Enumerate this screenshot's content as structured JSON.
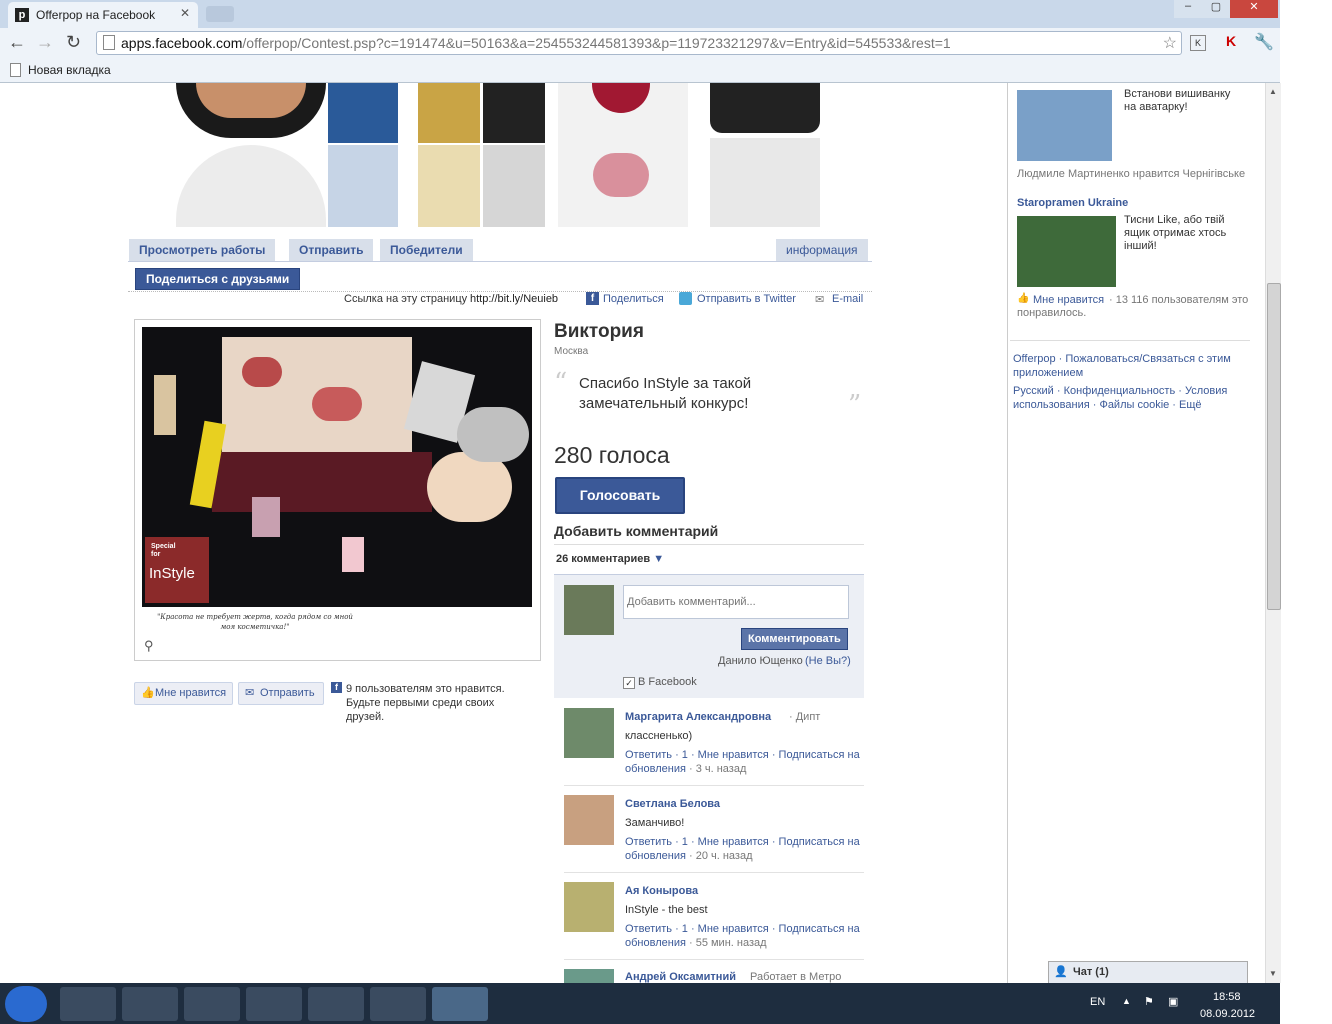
{
  "browser": {
    "tab_title": "Offerpop на Facebook",
    "url_host": "apps.facebook.com",
    "url_path": "/offerpop/Contest.psp?c=191474&u=50163&a=254553244581393&p=119723321297&v=Entry&id=545533&rest=1",
    "bookmark": "Новая вкладка"
  },
  "tabs": {
    "view": "Просмотреть работы",
    "send": "Отправить",
    "winners": "Победители",
    "info": "информация",
    "share": "Поделиться с друзьями"
  },
  "sharebar": {
    "link_label": "Ссылка на эту страницу",
    "link_url": "http://bit.ly/Neuieb",
    "share": "Поделиться",
    "twitter": "Отправить в Twitter",
    "email": "E-mail"
  },
  "entry": {
    "name": "Виктория",
    "city": "Москва",
    "quote": "Спасибо InStyle за такой замечательный конкурс!",
    "votes": "280 голоса",
    "vote_btn": "Голосовать",
    "badge_small": "Special for",
    "badge_big": "InStyle",
    "caption": "\"Красота не требует жертв, когда рядом со мной моя косметичка!\""
  },
  "likebar": {
    "like": "Мне нравится",
    "send": "Отправить",
    "text": "9 пользователям это нравится. Будьте первыми среди своих друзей."
  },
  "comments": {
    "title": "Добавить комментарий",
    "count": "26 комментариев",
    "placeholder": "Добавить комментарий...",
    "submit": "Комментировать",
    "user": "Данило Ющенко",
    "not_you": "(Не Вы?)",
    "facebook": "В Facebook",
    "items": [
      {
        "name": "Маргарита Александровна",
        "meta": "· Дипт",
        "text": "классненько)",
        "actions": "Ответить · 1 · Мне нравится · Подписаться на обновления",
        "time": "· 3 ч. назад"
      },
      {
        "name": "Светлана Белова",
        "meta": "",
        "text": "Заманчиво!",
        "actions": "Ответить · 1 · Мне нравится · Подписаться на обновления",
        "time": "· 20 ч. назад"
      },
      {
        "name": "Ая Конырова",
        "meta": "",
        "text": "InStyle - the best",
        "actions": "Ответить · 1 · Мне нравится · Подписаться на обновления",
        "time": "· 55 мин. назад"
      },
      {
        "name": "Андрей Оксамитний",
        "meta": "Работает в Метро",
        "text": "",
        "actions": "",
        "time": ""
      }
    ]
  },
  "sidebar": {
    "ad1_text": "Встанови вишиванку на аватарку!",
    "ad1_like": "Людмиле Мартиненко нравится Чернігівське",
    "ad2_title": "Staropramen Ukraine",
    "ad2_text": "Тисни Like, або твій ящик отримає хтось інший!",
    "ad2_like": "Мне нравится",
    "ad2_count": "· 13 116 пользователям это понравилось.",
    "footer1": "Offerpop · Пожаловаться/Связаться с этим приложением",
    "footer2": "Русский · Конфиденциальность · Условия использования · Файлы cookie · Ещё",
    "chat": "Чат (1)"
  },
  "taskbar": {
    "lang": "EN",
    "time": "18:58",
    "date": "08.09.2012"
  }
}
